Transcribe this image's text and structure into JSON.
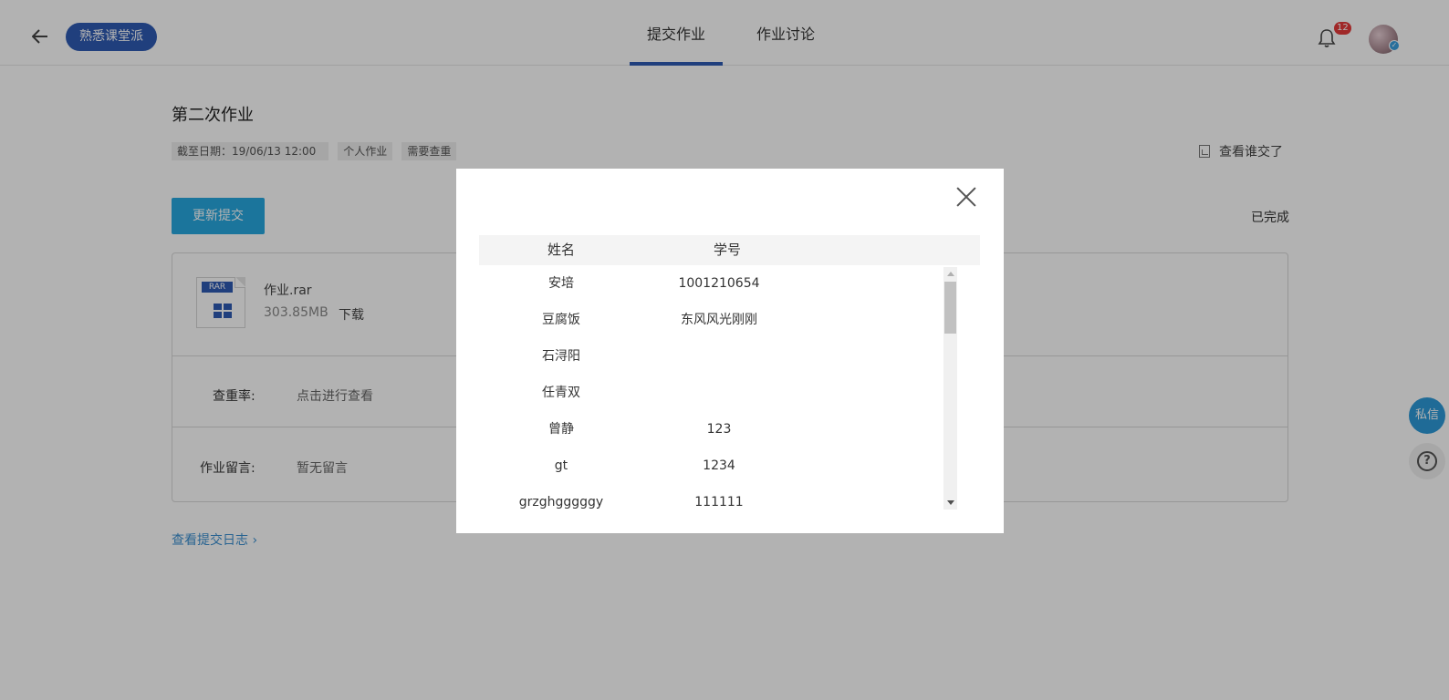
{
  "header": {
    "course_name": "熟悉课堂派",
    "tabs": [
      {
        "label": "提交作业",
        "active": true
      },
      {
        "label": "作业讨论",
        "active": false
      }
    ],
    "notification_count": "12"
  },
  "assignment": {
    "title": "第二次作业",
    "deadline": "截至日期：19/06/13  12:00",
    "type_tag": "个人作业",
    "check_tag": "需要查重",
    "who_submitted": "查看谁交了",
    "update_button": "更新提交",
    "status": "已完成",
    "file": {
      "badge": "RAR",
      "name": "作业.rar",
      "size": "303.85MB",
      "download": "下载"
    },
    "plagiarism_label": "查重率:",
    "plagiarism_value": "点击进行查看",
    "message_label": "作业留言:",
    "message_value": "暂无留言",
    "log_link": "查看提交日志 ›"
  },
  "sidebar_float": {
    "private_message": "私信",
    "help": "?"
  },
  "modal": {
    "columns": [
      "姓名",
      "学号"
    ],
    "rows": [
      {
        "name": "安培",
        "id": "1001210654"
      },
      {
        "name": "豆腐饭",
        "id": "东风风光刚刚"
      },
      {
        "name": "石浔阳",
        "id": ""
      },
      {
        "name": "任青双",
        "id": ""
      },
      {
        "name": "曾静",
        "id": "123"
      },
      {
        "name": "gt",
        "id": "1234"
      },
      {
        "name": "grzghgggggy",
        "id": "111111"
      }
    ]
  },
  "colors": {
    "primary": "#2f5bb3",
    "button": "#28a8e0",
    "link": "#3a8fd0",
    "overlay": "rgba(0,0,0,0.3)"
  }
}
